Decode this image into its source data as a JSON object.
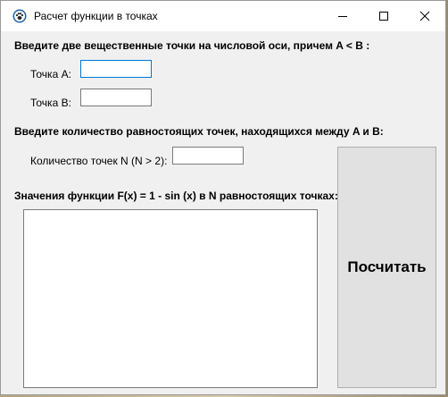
{
  "window": {
    "title": "Расчет функции в точках"
  },
  "titlebar": {
    "icons": [
      "app-paw-icon",
      "minimize-icon",
      "maximize-icon",
      "close-icon"
    ]
  },
  "section_points": {
    "heading": "Введите две вещественные точки на числовой оси, причем A < B :",
    "point_a_label": "Точка A:",
    "point_a_value": "",
    "point_b_label": "Точка B:",
    "point_b_value": ""
  },
  "section_count": {
    "heading": "Введите количество равностоящих точек, находящихся между A и B:",
    "count_label": "Количество точек N (N > 2):",
    "count_value": ""
  },
  "section_result": {
    "heading": "Значения функции F(x) = 1 - sin (x) в N равностоящих точках:",
    "output_value": ""
  },
  "calculate_button": {
    "label": "Посчитать"
  },
  "colors": {
    "accent": "#0078d7",
    "window_bg": "#f0f0f0",
    "button_bg": "#e1e1e1"
  }
}
